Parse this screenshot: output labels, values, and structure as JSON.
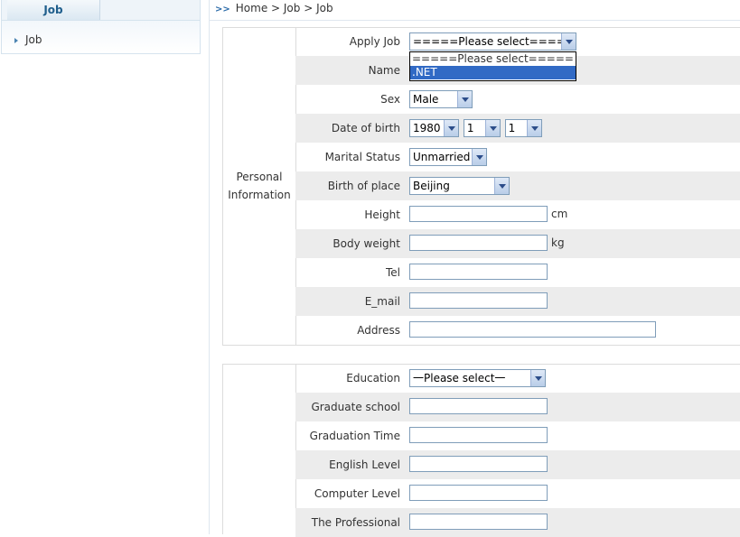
{
  "sidebar": {
    "header": "Job",
    "items": [
      {
        "label": "Job"
      }
    ]
  },
  "breadcrumb": "Home > Job > Job",
  "personal": {
    "group_label_1": "Personal",
    "group_label_2": "Information",
    "apply_job": {
      "label": "Apply Job",
      "value": "=====Please select=====",
      "options": [
        "=====Please select=====",
        ".NET"
      ],
      "highlighted": ".NET"
    },
    "name": {
      "label": "Name"
    },
    "sex": {
      "label": "Sex",
      "value": "Male"
    },
    "dob": {
      "label": "Date of birth",
      "year": "1980",
      "month": "1",
      "day": "1"
    },
    "marital": {
      "label": "Marital Status",
      "value": "Unmarried"
    },
    "birthplace": {
      "label": "Birth of place",
      "value": "Beijing"
    },
    "height": {
      "label": "Height",
      "unit": "cm"
    },
    "weight": {
      "label": "Body weight",
      "unit": "kg"
    },
    "tel": {
      "label": "Tel"
    },
    "email": {
      "label": "E_mail"
    },
    "address": {
      "label": "Address"
    }
  },
  "education": {
    "education": {
      "label": "Education",
      "value": "一Please select一"
    },
    "graduate_school": {
      "label": "Graduate school"
    },
    "graduation_time": {
      "label": "Graduation Time"
    },
    "english_level": {
      "label": "English Level"
    },
    "computer_level": {
      "label": "Computer Level"
    },
    "professional": {
      "label": "The Professional"
    }
  }
}
